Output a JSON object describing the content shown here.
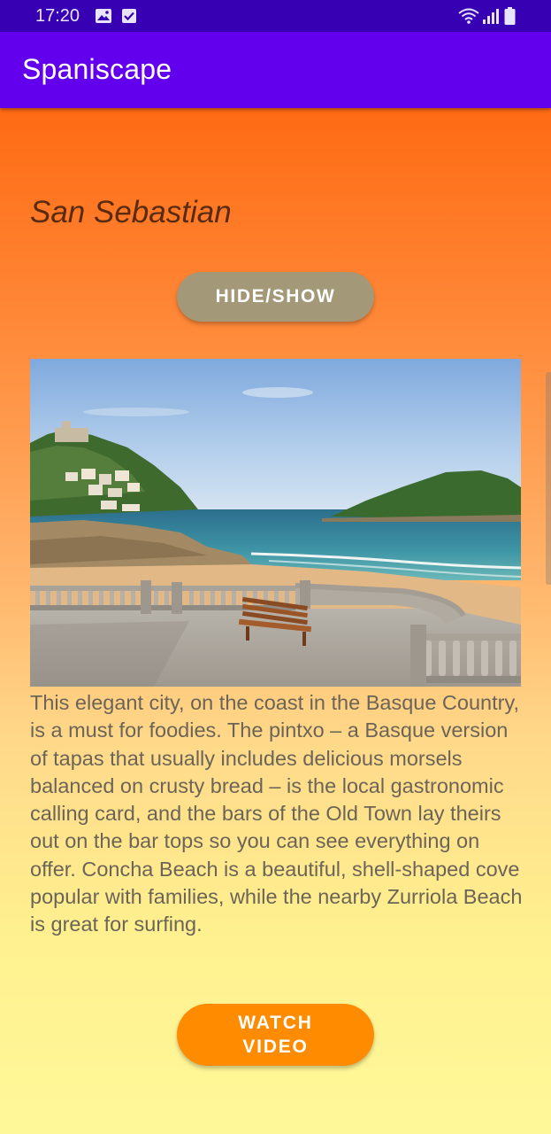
{
  "status_bar": {
    "time": "17:20",
    "left_icons": [
      "image-icon",
      "checkbox-icon"
    ],
    "right_icons": [
      "wifi-icon",
      "signal-icon",
      "battery-icon"
    ]
  },
  "app_bar": {
    "title": "Spaniscape",
    "color": "#6200EE"
  },
  "content": {
    "city_title": "San Sebastian",
    "hide_show_label": "HIDE/SHOW",
    "photo_subject": "beach-promenade-photo",
    "description": "This elegant city, on the coast in the Basque Country, is a must for foodies. The pintxo – a Basque version of tapas that usually includes delicious morsels balanced on crusty bread – is the local gastronomic calling card, and the bars of the Old Town lay theirs out on the bar tops so you can see everything on offer. Concha Beach is a beautiful, shell-shaped cove popular with families, while the nearby Zurriola Beach is great for surfing.",
    "watch_video_line1": "WATCH",
    "watch_video_line2": "VIDEO"
  },
  "colors": {
    "status_bar": "#3700B3",
    "accent_orange": "#FF8C00",
    "hide_button": "#A39878"
  }
}
